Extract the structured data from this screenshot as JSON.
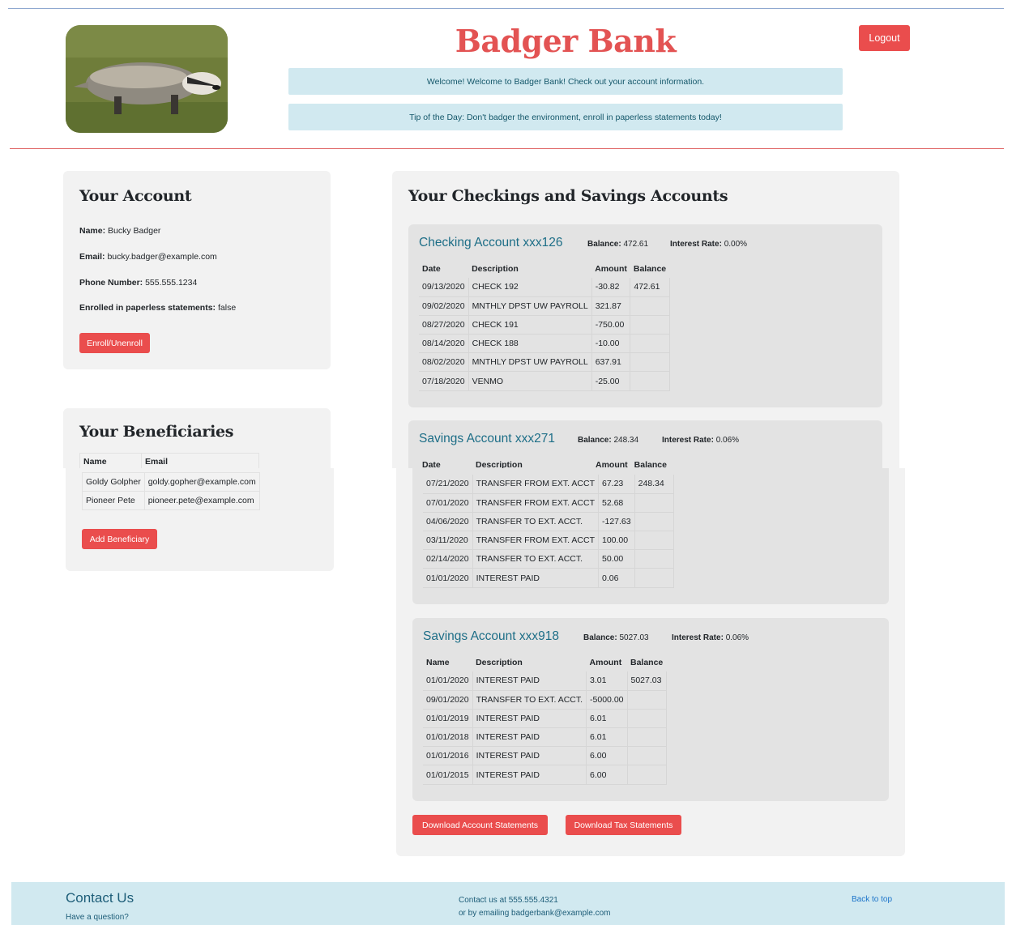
{
  "header": {
    "bank_name": "Badger Bank",
    "welcome": "Welcome! Welcome to Badger Bank! Check out your account information.",
    "tip": "Tip of the Day: Don't badger the environment, enroll in paperless statements today!",
    "logout_label": "Logout"
  },
  "account": {
    "title": "Your Account",
    "name_label": "Name:",
    "name": "Bucky Badger",
    "email_label": "Email:",
    "email": "bucky.badger@example.com",
    "phone_label": "Phone Number:",
    "phone": "555.555.1234",
    "paperless_label": "Enrolled in paperless statements:",
    "paperless": "false",
    "enroll_label": "Enroll/Unenroll"
  },
  "beneficiaries": {
    "title": "Your Beneficiaries",
    "headers": [
      "Name",
      "Email"
    ],
    "rows": [
      [
        "Goldy Golpher",
        "goldy.gopher@example.com"
      ],
      [
        "Pioneer Pete",
        "pioneer.pete@example.com"
      ]
    ],
    "add_label": "Add Beneficiary"
  },
  "accounts": {
    "title": "Your Checkings and Savings Accounts",
    "balance_label": "Balance:",
    "rate_label": "Interest Rate:",
    "list": [
      {
        "name": "Checking Account xxx126",
        "balance": "472.61",
        "rate": "0.00%",
        "headers": [
          "Date",
          "Description",
          "Amount",
          "Balance"
        ],
        "rows": [
          [
            "09/13/2020",
            "CHECK 192",
            "-30.82",
            "472.61"
          ],
          [
            "09/02/2020",
            "MNTHLY DPST UW PAYROLL",
            "321.87",
            ""
          ],
          [
            "08/27/2020",
            "CHECK 191",
            "-750.00",
            ""
          ],
          [
            "08/14/2020",
            "CHECK 188",
            "-10.00",
            ""
          ],
          [
            "08/02/2020",
            "MNTHLY DPST UW PAYROLL",
            "637.91",
            ""
          ],
          [
            "07/18/2020",
            "VENMO",
            "-25.00",
            ""
          ]
        ]
      },
      {
        "name": "Savings Account xxx271",
        "balance": "248.34",
        "rate": "0.06%",
        "headers": [
          "Date",
          "Description",
          "Amount",
          "Balance"
        ],
        "rows": [
          [
            "07/21/2020",
            "TRANSFER FROM EXT. ACCT",
            "67.23",
            "248.34"
          ],
          [
            "07/01/2020",
            "TRANSFER FROM EXT. ACCT",
            "52.68",
            ""
          ],
          [
            "04/06/2020",
            "TRANSFER TO EXT. ACCT.",
            "-127.63",
            ""
          ],
          [
            "03/11/2020",
            "TRANSFER FROM EXT. ACCT",
            "100.00",
            ""
          ],
          [
            "02/14/2020",
            "TRANSFER TO EXT. ACCT.",
            "50.00",
            ""
          ],
          [
            "01/01/2020",
            "INTEREST PAID",
            "0.06",
            ""
          ]
        ]
      },
      {
        "name": "Savings Account xxx918",
        "balance": "5027.03",
        "rate": "0.06%",
        "headers": [
          "Name",
          "Description",
          "Amount",
          "Balance"
        ],
        "rows": [
          [
            "01/01/2020",
            "INTEREST PAID",
            "3.01",
            "5027.03"
          ],
          [
            "09/01/2020",
            "TRANSFER TO EXT. ACCT.",
            "-5000.00",
            ""
          ],
          [
            "01/01/2019",
            "INTEREST PAID",
            "6.01",
            ""
          ],
          [
            "01/01/2018",
            "INTEREST PAID",
            "6.01",
            ""
          ],
          [
            "01/01/2016",
            "INTEREST PAID",
            "6.00",
            ""
          ],
          [
            "01/01/2015",
            "INTEREST PAID",
            "6.00",
            ""
          ]
        ]
      }
    ],
    "download_account_label": "Download Account Statements",
    "download_tax_label": "Download Tax Statements"
  },
  "footer": {
    "contact_title": "Contact Us",
    "contact_sub": "Have a question?",
    "contact_phone": "Contact us at 555.555.4321",
    "contact_email": "or by emailing badgerbank@example.com",
    "back_to_top": "Back to top"
  },
  "colors": {
    "brand": "#e35353",
    "button": "#ea4d4d",
    "alert_bg": "#d1e9f0",
    "account_title": "#1d6e87"
  }
}
